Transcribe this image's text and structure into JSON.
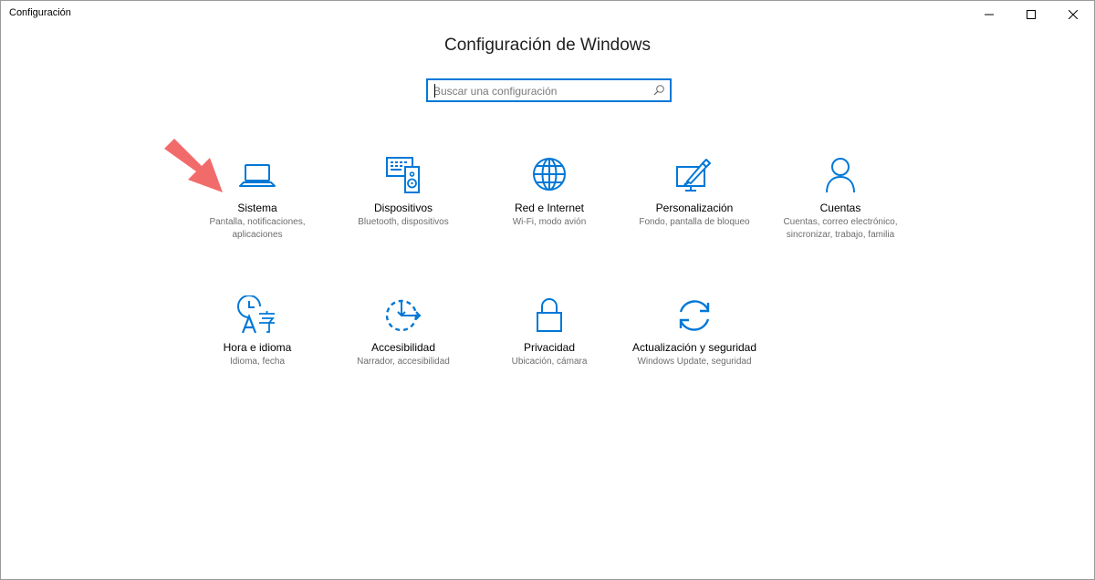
{
  "window": {
    "title": "Configuración",
    "controls": {
      "minimize": "minimize-icon",
      "maximize": "maximize-icon",
      "close": "close-icon"
    }
  },
  "header": {
    "title": "Configuración de Windows"
  },
  "search": {
    "placeholder": "Buscar una configuración",
    "value": ""
  },
  "colors": {
    "accent": "#0078d7",
    "annotation_arrow": "#f26b6b"
  },
  "tiles": [
    {
      "icon": "laptop-icon",
      "label": "Sistema",
      "desc": "Pantalla, notificaciones, aplicaciones"
    },
    {
      "icon": "devices-icon",
      "label": "Dispositivos",
      "desc": "Bluetooth, dispositivos"
    },
    {
      "icon": "globe-icon",
      "label": "Red e Internet",
      "desc": "Wi-Fi, modo avión"
    },
    {
      "icon": "personalization-icon",
      "label": "Personalización",
      "desc": "Fondo, pantalla de bloqueo"
    },
    {
      "icon": "person-icon",
      "label": "Cuentas",
      "desc": "Cuentas, correo electrónico, sincronizar, trabajo, familia"
    },
    {
      "icon": "time-language-icon",
      "label": "Hora e idioma",
      "desc": "Idioma, fecha"
    },
    {
      "icon": "accessibility-icon",
      "label": "Accesibilidad",
      "desc": "Narrador, accesibilidad"
    },
    {
      "icon": "lock-icon",
      "label": "Privacidad",
      "desc": "Ubicación, cámara"
    },
    {
      "icon": "update-icon",
      "label": "Actualización y seguridad",
      "desc": "Windows Update, seguridad"
    }
  ]
}
